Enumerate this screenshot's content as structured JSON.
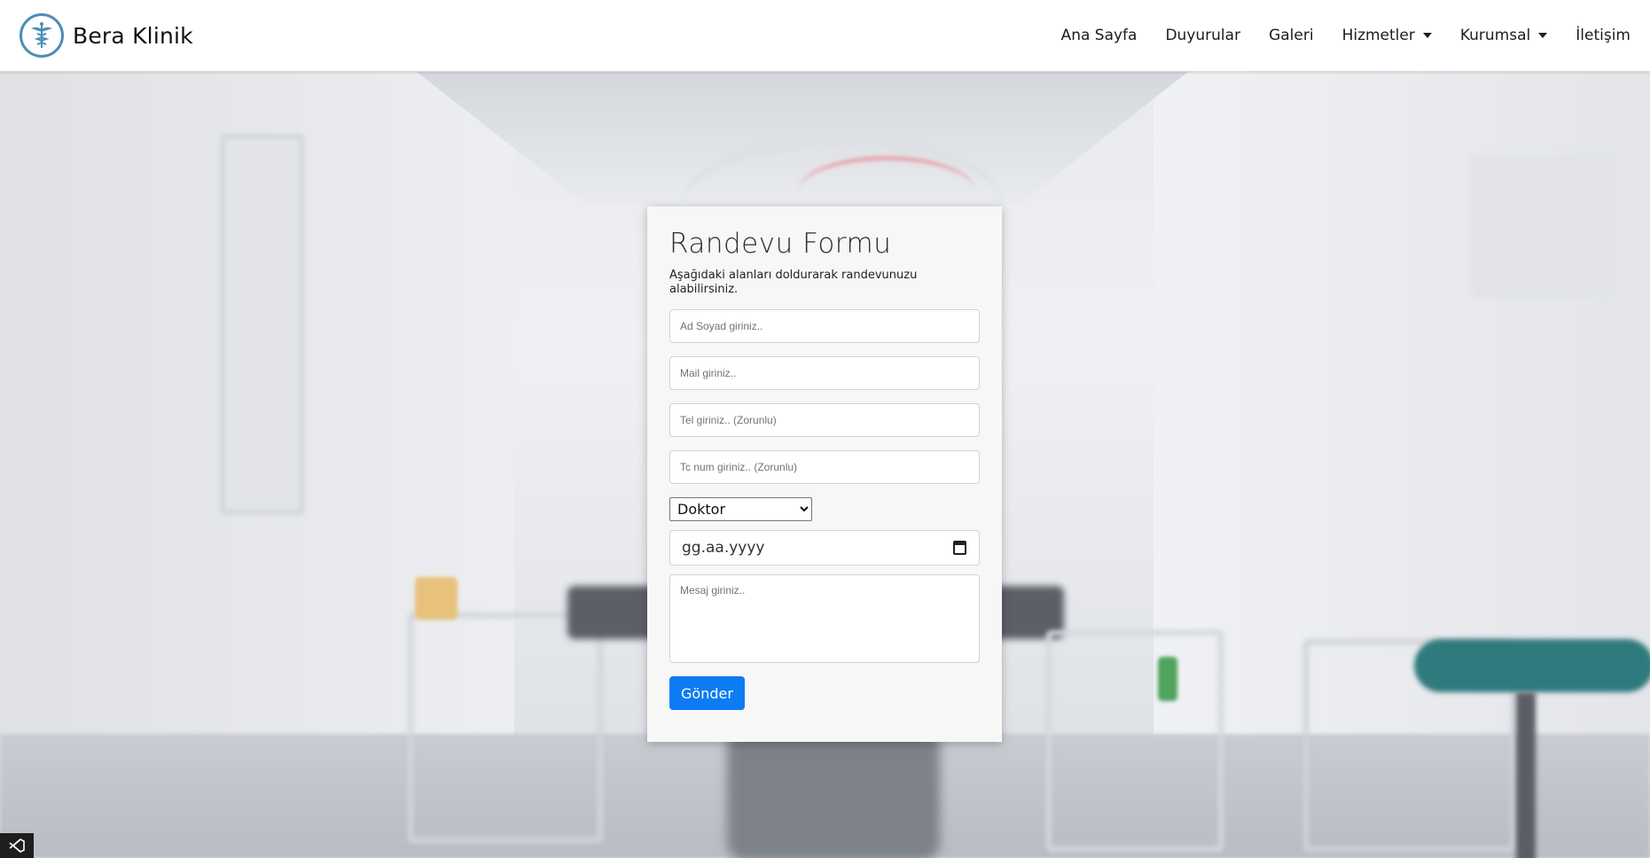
{
  "brand": {
    "name": "Bera Klinik",
    "icon": "caduceus-icon"
  },
  "nav": {
    "items": [
      {
        "label": "Ana Sayfa",
        "dropdown": false
      },
      {
        "label": "Duyurular",
        "dropdown": false
      },
      {
        "label": "Galeri",
        "dropdown": false
      },
      {
        "label": "Hizmetler",
        "dropdown": true
      },
      {
        "label": "Kurumsal",
        "dropdown": true
      },
      {
        "label": "İletişim",
        "dropdown": false
      }
    ]
  },
  "form": {
    "title": "Randevu Formu",
    "subtitle": "Aşağıdaki alanları doldurarak randevunuzu alabilirsiniz.",
    "name_placeholder": "Ad Soyad giriniz..",
    "mail_placeholder": "Mail giriniz..",
    "phone_placeholder": "Tel giriniz.. (Zorunlu)",
    "tc_placeholder": "Tc num giriniz.. (Zorunlu)",
    "doctor_selected": "Doktor",
    "date_placeholder": "gg.aa.yyyy",
    "message_placeholder": "Mesaj giriniz..",
    "submit_label": "Gönder"
  },
  "colors": {
    "accent": "#0d7bf4",
    "logo_ring": "#4b8fb5",
    "card_bg": "#f7f7f7"
  }
}
